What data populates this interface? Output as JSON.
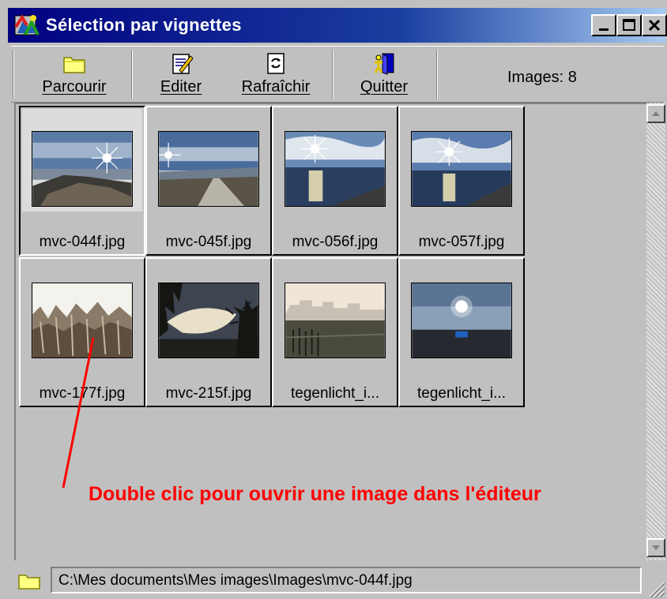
{
  "window": {
    "title": "Sélection par vignettes"
  },
  "toolbar": {
    "buttons": [
      {
        "label": "Parcourir",
        "icon": "folder-icon"
      },
      {
        "label": "Editer",
        "icon": "edit-icon"
      },
      {
        "label": "Rafraîchir",
        "icon": "refresh-icon"
      },
      {
        "label": "Quitter",
        "icon": "exit-icon"
      }
    ],
    "images_count": "Images: 8"
  },
  "thumbnails": [
    {
      "caption": "mvc-044f.jpg",
      "selected": true
    },
    {
      "caption": "mvc-045f.jpg",
      "selected": false
    },
    {
      "caption": "mvc-056f.jpg",
      "selected": false
    },
    {
      "caption": "mvc-057f.jpg",
      "selected": false
    },
    {
      "caption": "mvc-177f.jpg",
      "selected": false
    },
    {
      "caption": "mvc-215f.jpg",
      "selected": false
    },
    {
      "caption": "tegenlicht_i...",
      "selected": false
    },
    {
      "caption": "tegenlicht_i...",
      "selected": false
    }
  ],
  "annotation": "Double clic pour ouvrir une image dans l'éditeur",
  "statusbar": {
    "path": "C:\\Mes documents\\Mes images\\Images\\mvc-044f.jpg"
  },
  "colors": {
    "title_bar_start": "#000080",
    "title_bar_end": "#a6caf0",
    "annotation": "#ff0000",
    "face": "#c0c0c0"
  }
}
